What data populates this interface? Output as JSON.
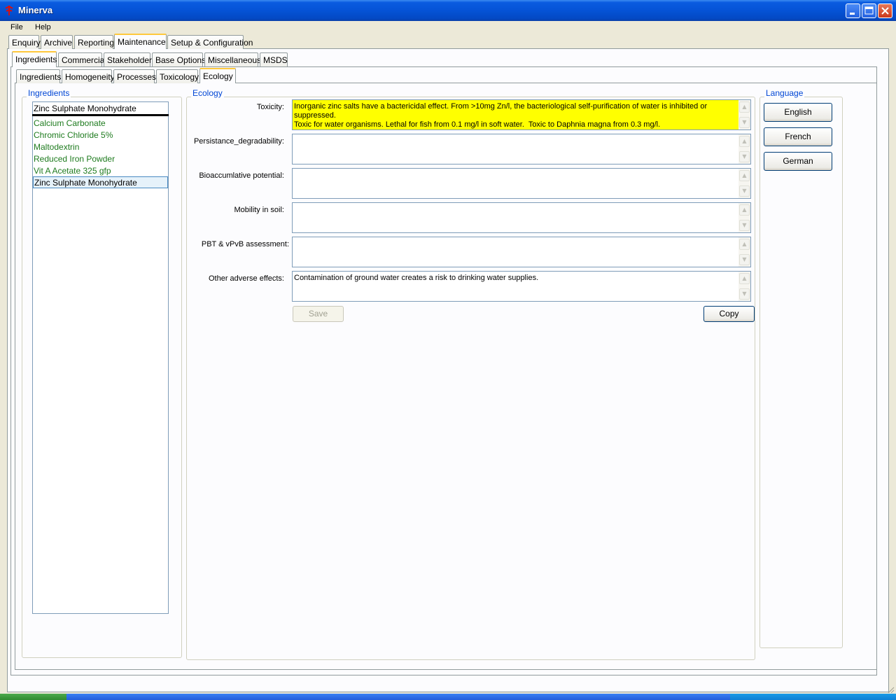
{
  "window": {
    "title": "Minerva"
  },
  "menu": [
    "File",
    "Help"
  ],
  "main_tabs": [
    "Enquiry",
    "Archive",
    "Reporting",
    "Maintenance",
    "Setup & Configuration"
  ],
  "sub_tabs": [
    "Ingredients",
    "Commercial",
    "Stakeholder",
    "Base Options",
    "Miscellaneous",
    "MSDS"
  ],
  "detail_tabs": [
    "Ingredients",
    "Homogeneity",
    "Processes",
    "Toxicology",
    "Ecology"
  ],
  "ingredients": {
    "legend": "Ingredients",
    "selected_value": "Zinc Sulphate Monohydrate",
    "items": [
      "Calcium Carbonate",
      "Chromic Chloride 5%",
      "Maltodextrin",
      "Reduced Iron Powder",
      "Vit A Acetate 325 gfp",
      "Zinc Sulphate Monohydrate"
    ]
  },
  "ecology": {
    "legend": "Ecology",
    "fields": [
      {
        "label": "Toxicity:",
        "value": "Inorganic zinc salts have a bactericidal effect. From >10mg Zn/l, the bacteriological self-purification of water is inhibited or suppressed.\nToxic for water organisms. Lethal for fish from 0.1 mg/l in soft water.  Toxic to Daphnia magna from 0.3 mg/l."
      },
      {
        "label": "Persistance_degradability:",
        "value": ""
      },
      {
        "label": "Bioaccumlative potential:",
        "value": ""
      },
      {
        "label": "Mobility in soil:",
        "value": ""
      },
      {
        "label": "PBT & vPvB assessment:",
        "value": ""
      },
      {
        "label": "Other adverse effects:",
        "value": "Contamination of ground water creates a risk to drinking water supplies."
      }
    ],
    "save_label": "Save",
    "copy_label": "Copy"
  },
  "language": {
    "legend": "Language",
    "buttons": [
      "English",
      "French",
      "German"
    ]
  },
  "colors": {
    "titlebar": "#0553d6",
    "highlight_field": "#ffff00",
    "list_text": "#1e7b1e",
    "legend_text": "#0046d5",
    "active_tab_accent": "#ffc83c"
  },
  "icons": [
    "minerva-app-icon",
    "minimize-icon",
    "maximize-icon",
    "close-icon",
    "scroll-up-icon",
    "scroll-down-icon"
  ]
}
